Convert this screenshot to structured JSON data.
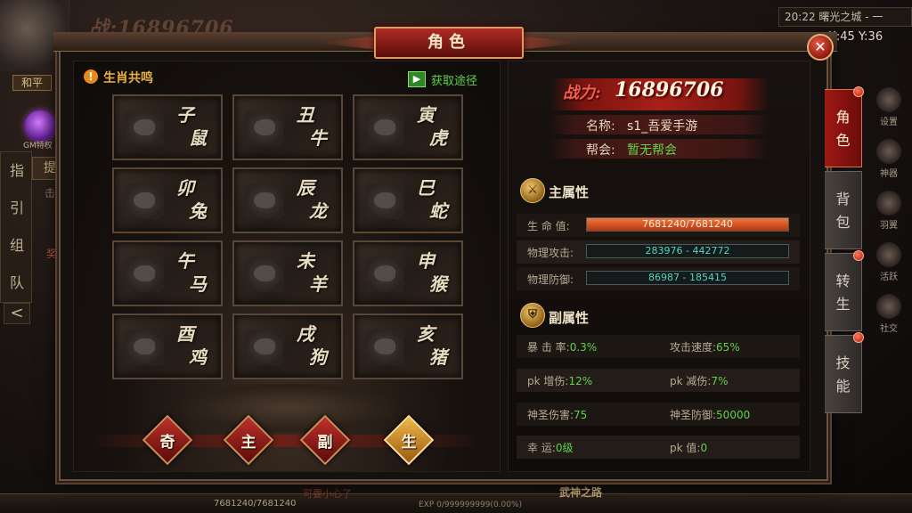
{
  "hud": {
    "power_value": "16896706",
    "power_prefix": "战:",
    "mode": "和平",
    "gem_label": "GM特权",
    "side_nav": [
      "指",
      "引",
      "组",
      "队"
    ],
    "guide_btn": "提",
    "guide_text": "击败",
    "reward_text": "奖",
    "time": "20:22",
    "map_name": "曙光之城 - 一",
    "coords": "X:45 Y:36",
    "right_icons": [
      "设置",
      "神器",
      "羽翼",
      "活跃",
      "社交"
    ],
    "hp_text": "7681240/7681240",
    "exp_text": "EXP 0/999999999(0.00%)",
    "hint_text": "可要小心了",
    "bottom_title": "武神之路"
  },
  "panel": {
    "title": "角色",
    "close_glyph": "✕"
  },
  "zodiac": {
    "title": "生肖共鸣",
    "get_way": "获取途径",
    "get_way_icon": "▶",
    "cells": [
      {
        "top": "子",
        "bottom": "鼠"
      },
      {
        "top": "丑",
        "bottom": "牛"
      },
      {
        "top": "寅",
        "bottom": "虎"
      },
      {
        "top": "卯",
        "bottom": "兔"
      },
      {
        "top": "辰",
        "bottom": "龙"
      },
      {
        "top": "巳",
        "bottom": "蛇"
      },
      {
        "top": "午",
        "bottom": "马"
      },
      {
        "top": "未",
        "bottom": "羊"
      },
      {
        "top": "申",
        "bottom": "猴"
      },
      {
        "top": "酉",
        "bottom": "鸡"
      },
      {
        "top": "戌",
        "bottom": "狗"
      },
      {
        "top": "亥",
        "bottom": "猪"
      }
    ],
    "tabs": [
      "奇",
      "主",
      "副",
      "生"
    ],
    "active_tab": "生"
  },
  "character": {
    "power_label": "战力:",
    "power_value": "16896706",
    "name_key": "名称:",
    "name_value": "s1_吾爱手游",
    "guild_key": "帮会:",
    "guild_value": "暂无帮会",
    "name_color": "#e8dcc8",
    "guild_color": "#5ed34a"
  },
  "main_attr": {
    "title": "主属性",
    "hp_label": "生 命 值:",
    "hp_value": "7681240/7681240",
    "hp_fraction": 1.0,
    "atk_label": "物理攻击:",
    "atk_value": "283976 - 442772",
    "def_label": "物理防御:",
    "def_value": "86987 - 185415"
  },
  "sub_attr": {
    "title": "副属性",
    "rows": [
      [
        {
          "k": "暴 击 率:",
          "v": "0.3%"
        },
        {
          "k": "攻击速度:",
          "v": "65%"
        }
      ],
      [
        {
          "k": "pk   增伤:",
          "v": "12%"
        },
        {
          "k": "pk   减伤:",
          "v": "7%"
        }
      ],
      [
        {
          "k": "神圣伤害:",
          "v": "75"
        },
        {
          "k": "神圣防御:",
          "v": "50000"
        }
      ],
      [
        {
          "k": "幸      运:",
          "v": "0级"
        },
        {
          "k": "pk      值:",
          "v": "0"
        }
      ]
    ]
  },
  "side_tabs": [
    {
      "label": "角色",
      "active": true,
      "dot": true
    },
    {
      "label": "背包",
      "active": false,
      "dot": false
    },
    {
      "label": "转生",
      "active": false,
      "dot": true
    },
    {
      "label": "技能",
      "active": false,
      "dot": true
    }
  ]
}
